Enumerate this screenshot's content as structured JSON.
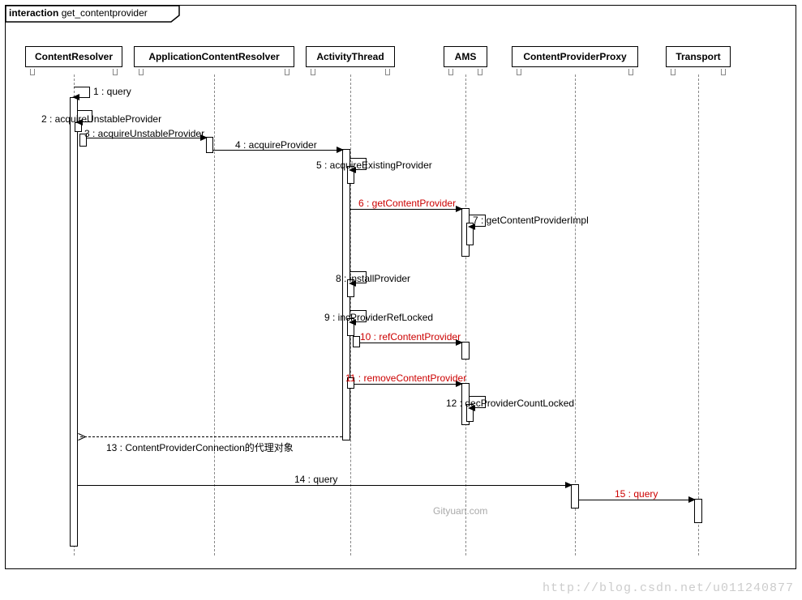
{
  "frame": {
    "keyword": "interaction",
    "name": "get_contentprovider"
  },
  "lifelines": {
    "cr": "ContentResolver",
    "acr": "ApplicationContentResolver",
    "at": "ActivityThread",
    "ams": "AMS",
    "cpp": "ContentProviderProxy",
    "tr": "Transport"
  },
  "messages": {
    "m1": "1 : query",
    "m2": "2 : acquireUnstableProvider",
    "m3": "3 : acquireUnstableProvider",
    "m4": "4 : acquireProvider",
    "m5": "5 : acquireExistingProvider",
    "m6": "6 : getContentProvider",
    "m7": "7 : getContentProviderImpl",
    "m8": "8 : installProvider",
    "m9": "9 : incProviderRefLocked",
    "m10": "10 : refContentProvider",
    "m11": "11 : removeContentProvider",
    "m12": "12 : decProviderCountLocked",
    "m13": "13 : ContentProviderConnection的代理对象",
    "m14": "14 : query",
    "m15": "15 : query"
  },
  "watermark": "Gityuan.com",
  "url": "http://blog.csdn.net/u011240877",
  "chart_data": {
    "type": "sequence-diagram",
    "title": "interaction get_contentprovider",
    "participants": [
      "ContentResolver",
      "ApplicationContentResolver",
      "ActivityThread",
      "AMS",
      "ContentProviderProxy",
      "Transport"
    ],
    "messages": [
      {
        "n": 1,
        "from": "ContentResolver",
        "to": "ContentResolver",
        "label": "query",
        "self": true
      },
      {
        "n": 2,
        "from": "ContentResolver",
        "to": "ContentResolver",
        "label": "acquireUnstableProvider",
        "self": true
      },
      {
        "n": 3,
        "from": "ContentResolver",
        "to": "ApplicationContentResolver",
        "label": "acquireUnstableProvider"
      },
      {
        "n": 4,
        "from": "ApplicationContentResolver",
        "to": "ActivityThread",
        "label": "acquireProvider"
      },
      {
        "n": 5,
        "from": "ActivityThread",
        "to": "ActivityThread",
        "label": "acquireExistingProvider",
        "self": true
      },
      {
        "n": 6,
        "from": "ActivityThread",
        "to": "AMS",
        "label": "getContentProvider",
        "highlight": true
      },
      {
        "n": 7,
        "from": "AMS",
        "to": "AMS",
        "label": "getContentProviderImpl",
        "self": true
      },
      {
        "n": 8,
        "from": "ActivityThread",
        "to": "ActivityThread",
        "label": "installProvider",
        "self": true
      },
      {
        "n": 9,
        "from": "ActivityThread",
        "to": "ActivityThread",
        "label": "incProviderRefLocked",
        "self": true
      },
      {
        "n": 10,
        "from": "ActivityThread",
        "to": "AMS",
        "label": "refContentProvider",
        "highlight": true
      },
      {
        "n": 11,
        "from": "ActivityThread",
        "to": "AMS",
        "label": "removeContentProvider",
        "highlight": true
      },
      {
        "n": 12,
        "from": "AMS",
        "to": "AMS",
        "label": "decProviderCountLocked",
        "self": true
      },
      {
        "n": 13,
        "from": "ActivityThread",
        "to": "ContentResolver",
        "label": "ContentProviderConnection的代理对象",
        "return": true
      },
      {
        "n": 14,
        "from": "ContentResolver",
        "to": "ContentProviderProxy",
        "label": "query"
      },
      {
        "n": 15,
        "from": "ContentProviderProxy",
        "to": "Transport",
        "label": "query",
        "highlight": true
      }
    ]
  }
}
